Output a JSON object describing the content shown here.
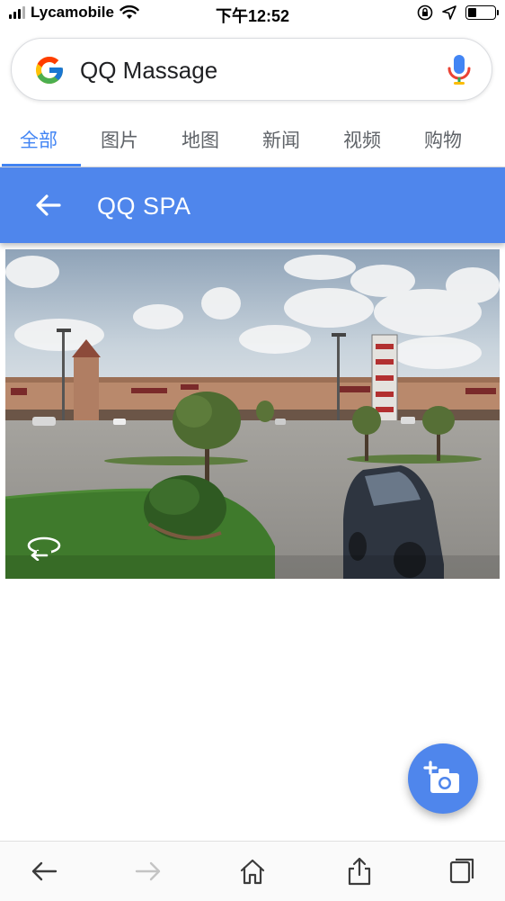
{
  "status_bar": {
    "carrier": "Lycamobile",
    "time": "下午12:52",
    "battery_level": 0.35
  },
  "search": {
    "query": "QQ Massage",
    "logo_icon": "google-g-icon",
    "mic_icon": "microphone-icon"
  },
  "tabs": [
    {
      "label": "全部",
      "active": true
    },
    {
      "label": "图片",
      "active": false
    },
    {
      "label": "地图",
      "active": false
    },
    {
      "label": "新闻",
      "active": false
    },
    {
      "label": "视频",
      "active": false
    },
    {
      "label": "购物",
      "active": false
    }
  ],
  "place_header": {
    "title": "QQ SPA",
    "back_icon": "back-arrow-icon"
  },
  "street_view": {
    "rotate_icon": "rotate-360-icon"
  },
  "fab": {
    "icon": "add-photo-camera-icon"
  },
  "bottom_bar": {
    "buttons": [
      "back-arrow-icon",
      "forward-arrow-icon",
      "home-icon",
      "share-icon",
      "tabs-icon"
    ]
  },
  "colors": {
    "accent_blue": "#4285f4",
    "header_blue": "#4f86ec",
    "tab_inactive": "#5f6368"
  }
}
